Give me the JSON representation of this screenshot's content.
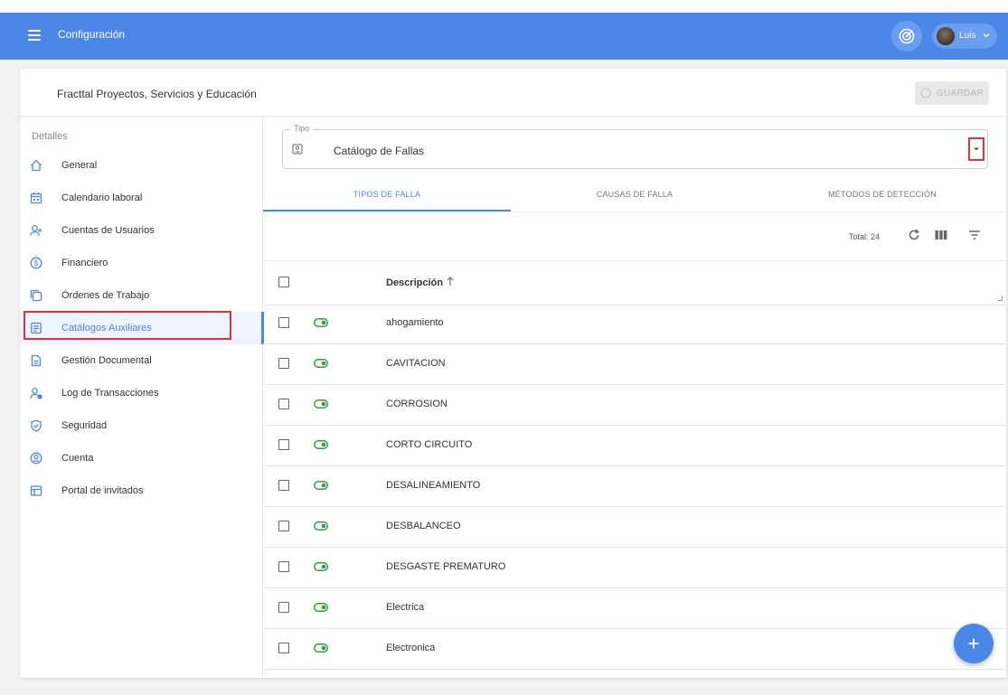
{
  "topbar": {
    "title": "Configuración",
    "user": "Luis"
  },
  "header": {
    "company": "Fracttal Proyectos, Servicios y Educación",
    "save_label": "GUARDAR"
  },
  "sidebar": {
    "heading": "Detalles",
    "items": [
      {
        "label": "General",
        "icon": "home-icon"
      },
      {
        "label": "Calendario laboral",
        "icon": "calendar-icon"
      },
      {
        "label": "Cuentas de Usuarios",
        "icon": "user-add-icon"
      },
      {
        "label": "Financiero",
        "icon": "dollar-icon"
      },
      {
        "label": "Órdenes de Trabajo",
        "icon": "copy-icon"
      },
      {
        "label": "Catálogos Auxiliares",
        "icon": "catalog-icon",
        "active": true
      },
      {
        "label": "Gestión Documental",
        "icon": "document-icon"
      },
      {
        "label": "Log de Transacciones",
        "icon": "user-log-icon"
      },
      {
        "label": "Seguridad",
        "icon": "shield-icon"
      },
      {
        "label": "Cuenta",
        "icon": "account-icon"
      },
      {
        "label": "Portal de invitados",
        "icon": "portal-icon"
      }
    ]
  },
  "tipo": {
    "legend": "Tipo",
    "value": "Catálogo de Fallas"
  },
  "tabs": [
    {
      "label": "TIPOS DE FALLA",
      "active": true
    },
    {
      "label": "CAUSAS DE FALLA"
    },
    {
      "label": "MÉTODOS DE DETECCIÓN"
    }
  ],
  "toolbar": {
    "total": "Total: 24"
  },
  "table": {
    "header": "Descripción",
    "rows": [
      {
        "description": "ahogamiento",
        "enabled": true
      },
      {
        "description": "CAVITACION",
        "enabled": true
      },
      {
        "description": "CORROSION",
        "enabled": true
      },
      {
        "description": "CORTO CIRCUITO",
        "enabled": true
      },
      {
        "description": "DESALINEAMIENTO",
        "enabled": true
      },
      {
        "description": "DESBALANCEO",
        "enabled": true
      },
      {
        "description": "DESGASTE PREMATURO",
        "enabled": true
      },
      {
        "description": "Electrica",
        "enabled": true
      },
      {
        "description": "Electronica",
        "enabled": true
      }
    ]
  },
  "colors": {
    "primary": "#4a87e6",
    "highlight": "#e0303a",
    "toggle": "#2e9e44"
  }
}
